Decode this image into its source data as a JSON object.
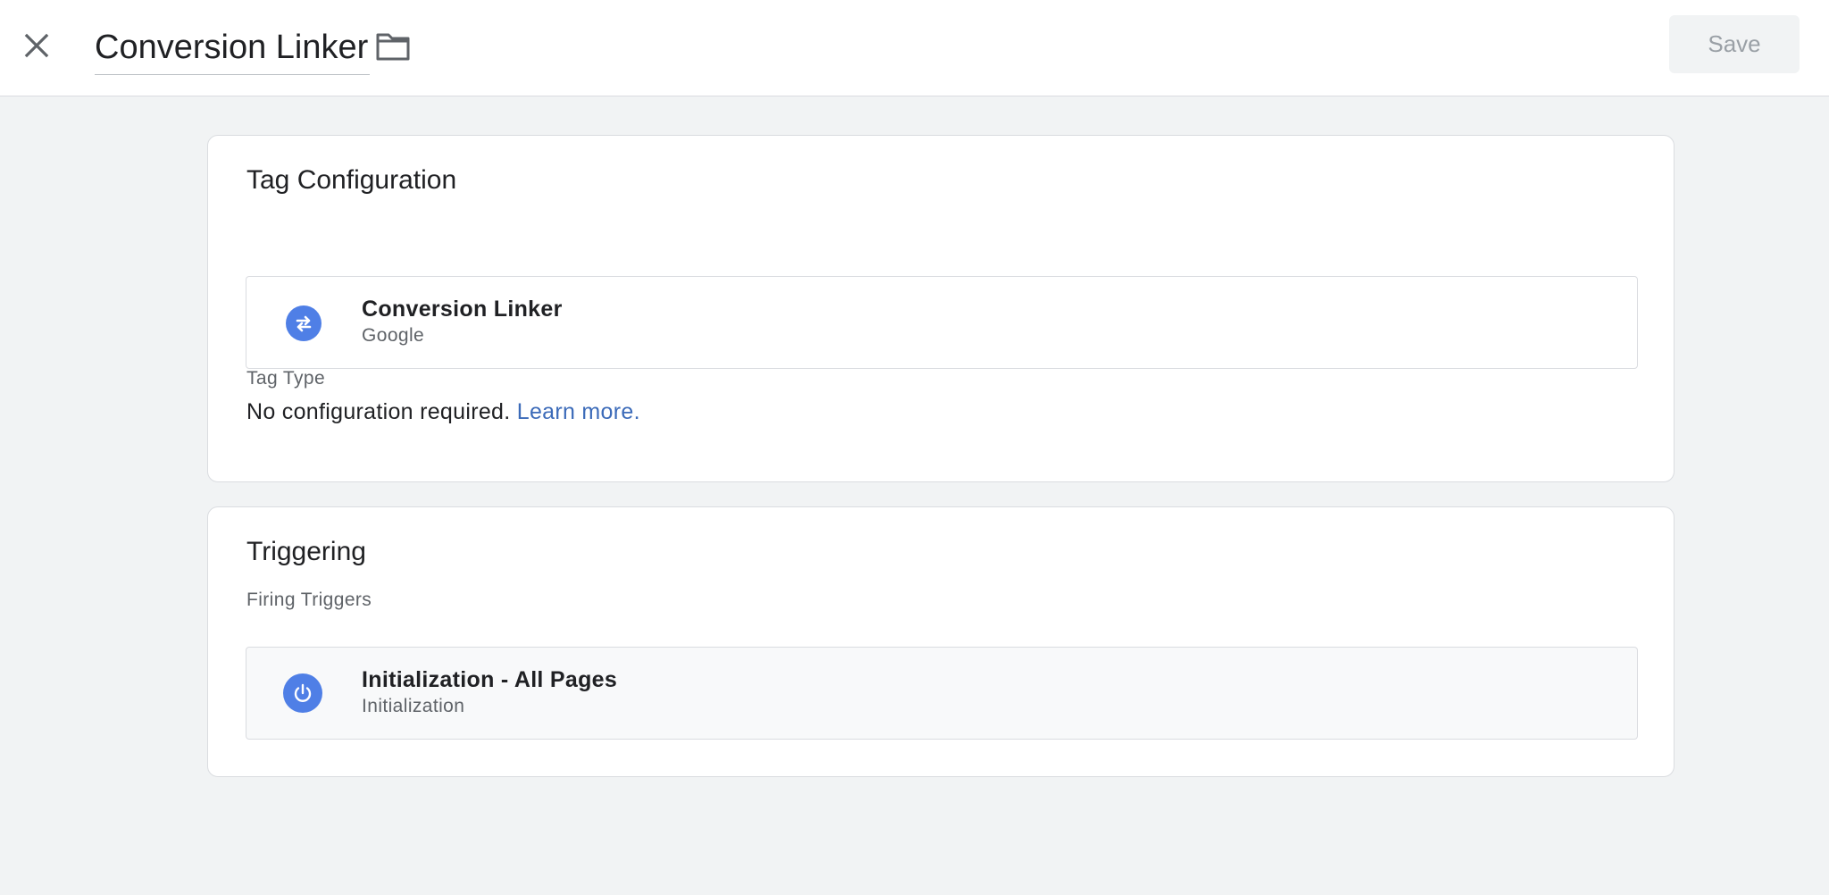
{
  "header": {
    "title": "Conversion Linker",
    "close_icon": "close-icon",
    "folder_icon": "folder-icon",
    "save_label": "Save"
  },
  "tag_configuration": {
    "title": "Tag Configuration",
    "tag_type_label": "Tag Type",
    "tag_type": {
      "name": "Conversion Linker",
      "provider": "Google",
      "icon": "swap-arrows-icon"
    },
    "info_text": "No configuration required.",
    "learn_more": "Learn more."
  },
  "triggering": {
    "title": "Triggering",
    "firing_label": "Firing Triggers",
    "trigger": {
      "name": "Initialization - All Pages",
      "type": "Initialization",
      "icon": "power-icon"
    }
  },
  "colors": {
    "accent_blue": "#4f7fe6",
    "link_blue": "#3c6bb9",
    "page_bg": "#f1f3f4"
  }
}
